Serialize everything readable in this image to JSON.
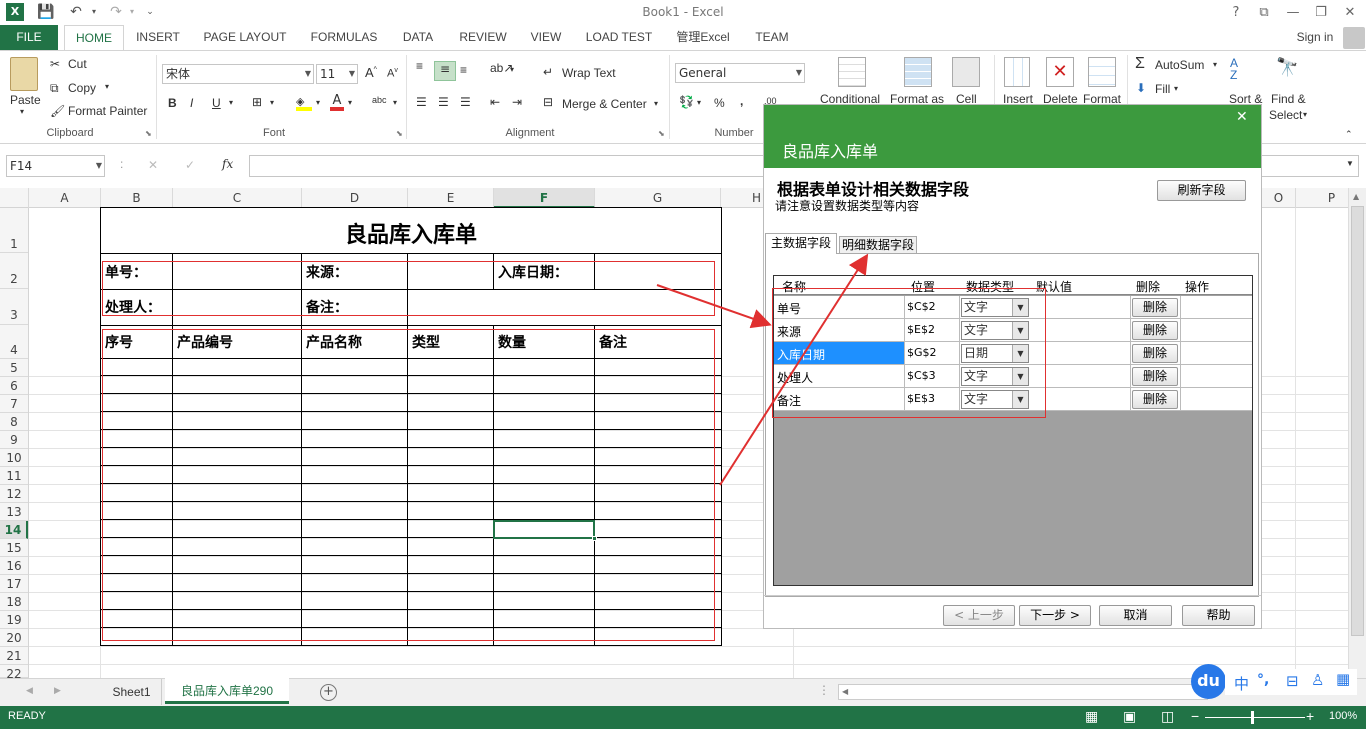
{
  "window": {
    "title": "Book1 - Excel",
    "help": "?",
    "restore_ribbon": "⧉",
    "minimize": "—",
    "maximize": "❐",
    "close": "✕"
  },
  "tabs": [
    "FILE",
    "HOME",
    "INSERT",
    "PAGE LAYOUT",
    "FORMULAS",
    "DATA",
    "REVIEW",
    "VIEW",
    "LOAD TEST",
    "管理Excel",
    "TEAM"
  ],
  "signin": "Sign in",
  "ribbon": {
    "clipboard": {
      "paste": "Paste",
      "cut": "Cut",
      "copy": "Copy",
      "format_painter": "Format Painter",
      "label": "Clipboard"
    },
    "font": {
      "name": "宋体",
      "size": "11",
      "bold": "B",
      "italic": "I",
      "underline": "U",
      "label": "Font"
    },
    "alignment": {
      "wrap": "Wrap Text",
      "merge": "Merge & Center",
      "label": "Alignment"
    },
    "number": {
      "format": "General",
      "label": "Number",
      "percent": "%",
      "comma": ","
    },
    "styles": {
      "conditional": "Conditional",
      "format_as": "Format as",
      "cell": "Cell"
    },
    "cells": {
      "insert": "Insert",
      "delete": "Delete",
      "format": "Format"
    },
    "editing": {
      "autosum": "AutoSum",
      "fill": "Fill",
      "sort": "Sort &",
      "find": "Find &",
      "select": "Select"
    }
  },
  "formula_bar": {
    "name_box": "F14",
    "fx": "fx",
    "cancel": "✕",
    "enter": "✓",
    "colon": ":"
  },
  "columns": [
    "A",
    "B",
    "C",
    "D",
    "E",
    "F",
    "G",
    "H",
    "P"
  ],
  "rows": [
    "1",
    "2",
    "3",
    "4",
    "5",
    "6",
    "7",
    "8",
    "9",
    "10",
    "11",
    "12",
    "13",
    "14",
    "15",
    "16",
    "17",
    "18",
    "19",
    "20",
    "21",
    "22"
  ],
  "sheet": {
    "title": "良品库入库单",
    "r2_b": "单号：",
    "r2_d": "来源：",
    "r2_f": "入库日期：",
    "r3_b": "处理人：",
    "r3_d": "备注：",
    "headers": [
      "序号",
      "产品编号",
      "产品名称",
      "类型",
      "数量",
      "备注"
    ]
  },
  "sheet_tabs": [
    "Sheet1",
    "良品库入库单290"
  ],
  "status": {
    "ready": "READY",
    "zoom": "100%",
    "minus": "−",
    "plus": "+"
  },
  "dialog": {
    "title": "良品库入库单",
    "close": "✕",
    "heading": "根据表单设计相关数据字段",
    "subheading": "请注意设置数据类型等内容",
    "refresh": "刷新字段",
    "tabs": [
      "主数据字段",
      "明细数据字段"
    ],
    "columns": [
      "名称",
      "位置",
      "数据类型",
      "默认值",
      "删除",
      "操作"
    ],
    "rows": [
      {
        "name": "单号",
        "pos": "$C$2",
        "type": "文字",
        "del": "删除"
      },
      {
        "name": "来源",
        "pos": "$E$2",
        "type": "文字",
        "del": "删除"
      },
      {
        "name": "入库日期",
        "pos": "$G$2",
        "type": "日期",
        "del": "删除"
      },
      {
        "name": "处理人",
        "pos": "$C$3",
        "type": "文字",
        "del": "删除"
      },
      {
        "name": "备注",
        "pos": "$E$3",
        "type": "文字",
        "del": "删除"
      }
    ],
    "buttons": {
      "prev": "< 上一步",
      "next": "下一步 >",
      "cancel": "取消",
      "help": "帮助"
    }
  },
  "ime": {
    "logo": "du",
    "lang": "中",
    "punct": "°,"
  },
  "colors": {
    "excel_green": "#217346",
    "dialog_green": "#3c9a3e",
    "highlight_red": "#e03030",
    "select_blue": "#1e90ff"
  }
}
